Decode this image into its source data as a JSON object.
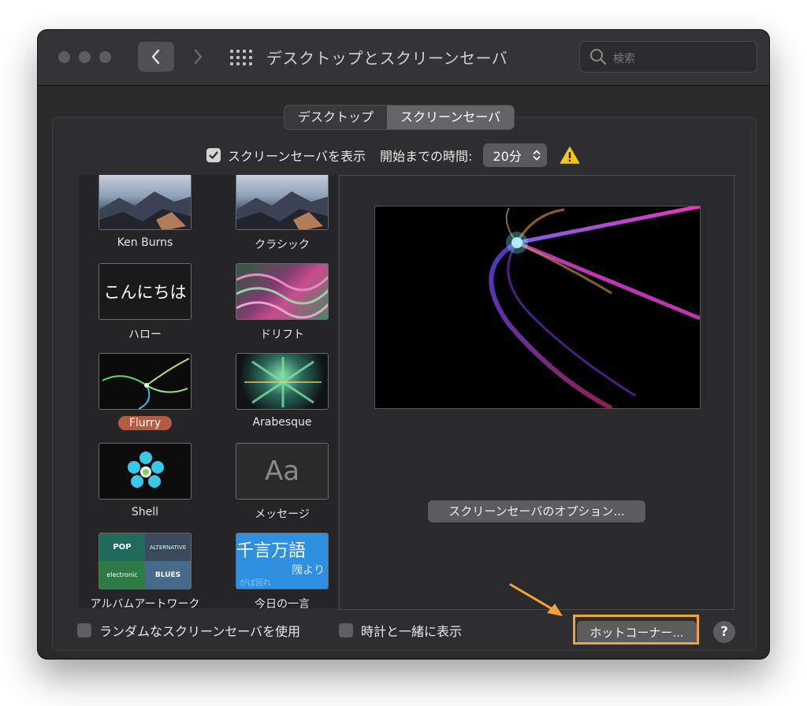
{
  "window": {
    "title": "デスクトップとスクリーンセーバ"
  },
  "search": {
    "placeholder": "検索"
  },
  "tabs": [
    {
      "label": "デスクトップ",
      "active": false
    },
    {
      "label": "スクリーンセーバ",
      "active": true
    }
  ],
  "settings": {
    "show_screensaver": {
      "label": "スクリーンセーバを表示",
      "checked": true
    },
    "start_after_label": "開始までの時間:",
    "start_after_value": "20分"
  },
  "screensavers": [
    {
      "label": "Ken Burns",
      "selected": false
    },
    {
      "label": "クラシック",
      "selected": false
    },
    {
      "label": "ハロー",
      "selected": false,
      "thumb_text": "こんにちは"
    },
    {
      "label": "ドリフト",
      "selected": false
    },
    {
      "label": "Flurry",
      "selected": true
    },
    {
      "label": "Arabesque",
      "selected": false
    },
    {
      "label": "Shell",
      "selected": false
    },
    {
      "label": "メッセージ",
      "selected": false,
      "thumb_text": "Aa"
    },
    {
      "label": "アルバムアートワーク",
      "selected": false,
      "thumb_texts": [
        "POP",
        "ALTERNATIVE",
        "electronic",
        "BLUES"
      ]
    },
    {
      "label": "今日の一言",
      "selected": false,
      "thumb_text1": "千言万語",
      "thumb_text2": "隗より",
      "thumb_text3": "がば回れ"
    }
  ],
  "preview": {
    "options_button": "スクリーンセーバのオプション..."
  },
  "bottom": {
    "random": {
      "label": "ランダムなスクリーンセーバを使用",
      "checked": false
    },
    "clock": {
      "label": "時計と一緒に表示",
      "checked": false
    },
    "hot_corners_button": "ホットコーナー...",
    "help_button": "?"
  },
  "colors": {
    "accent_selected": "#b65b40",
    "annotation_orange": "#f1a23a",
    "warning_yellow": "#f5c518"
  },
  "icons": [
    "back-chevron-icon",
    "forward-chevron-icon",
    "show-all-grid-icon",
    "search-icon",
    "checkmark-icon",
    "stepper-updown-icon",
    "warning-icon",
    "help-icon"
  ]
}
